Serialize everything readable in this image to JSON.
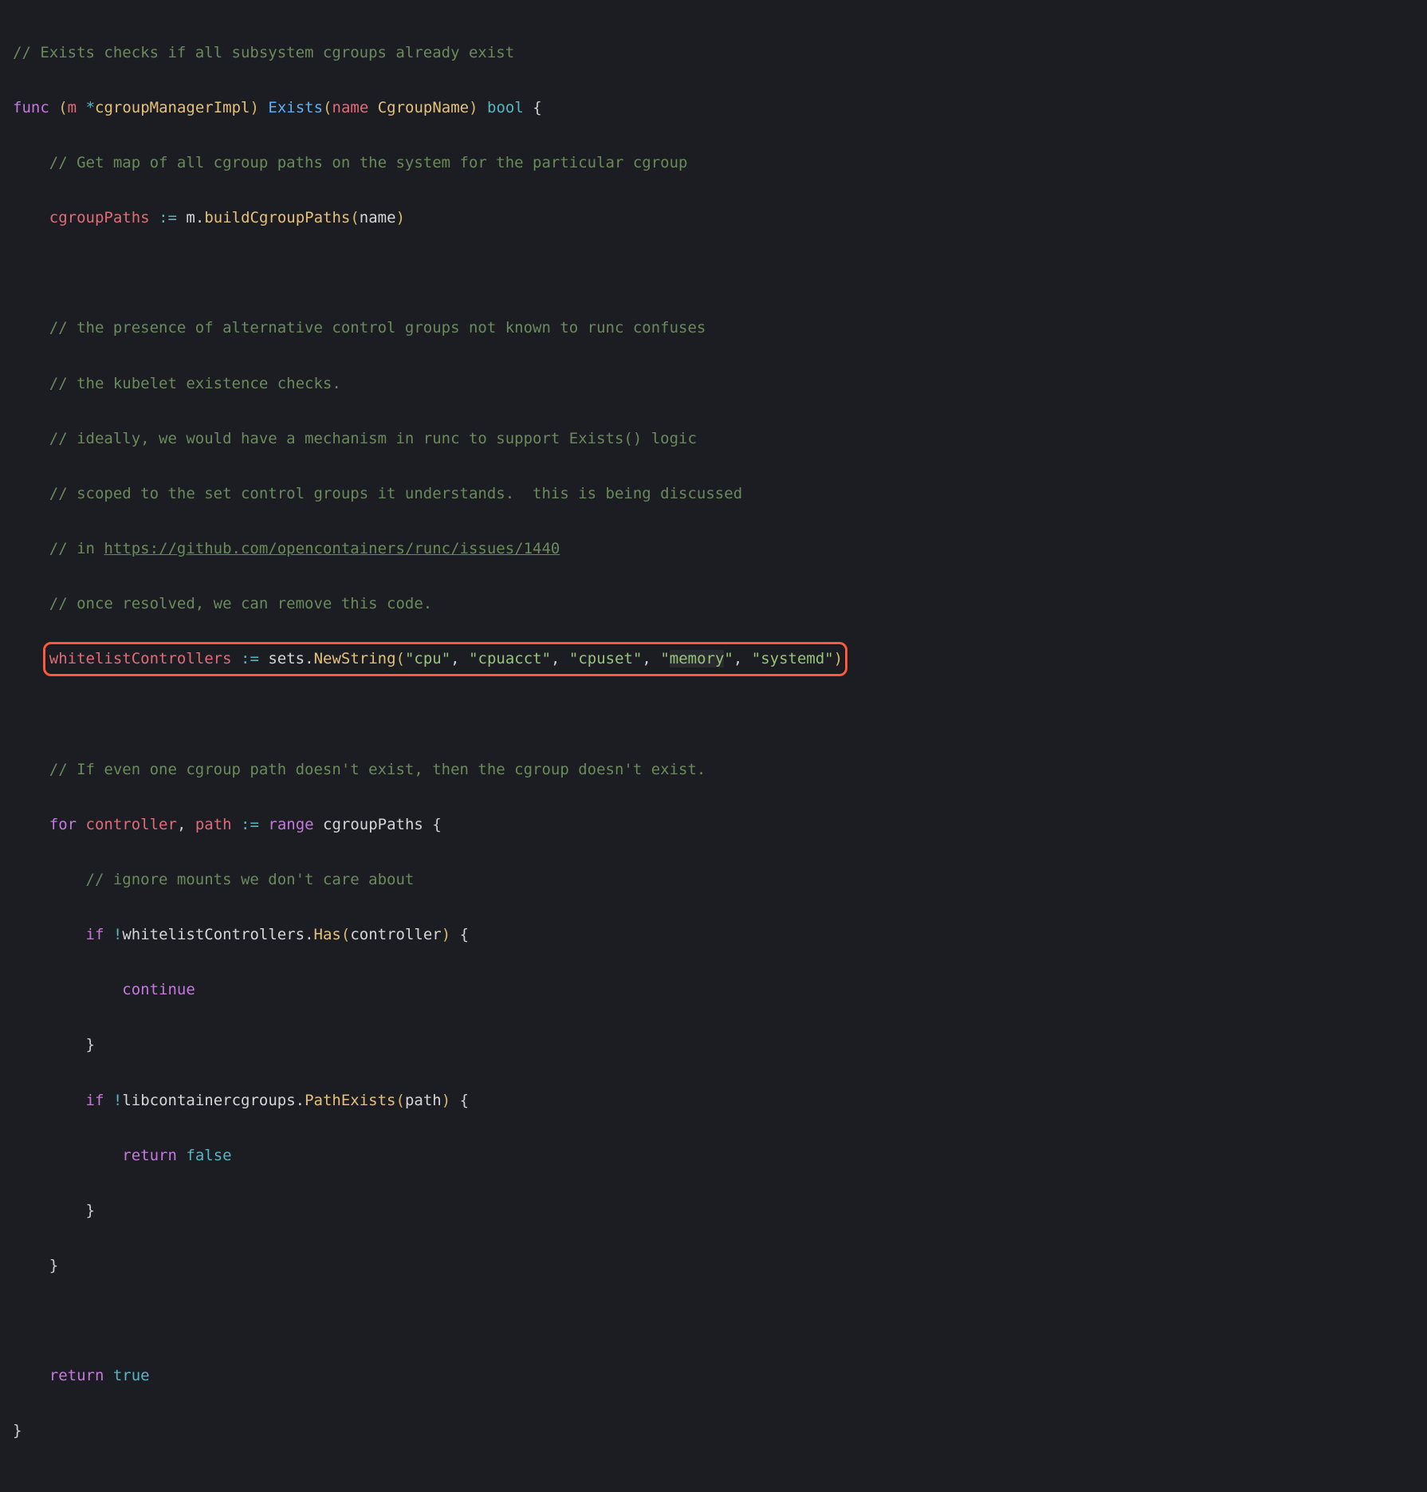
{
  "code": {
    "c_exists_doc": "// Exists checks if all subsystem cgroups already exist",
    "kw_func": "func",
    "recv_open": "(",
    "recv_m": "m",
    "recv_star": "*",
    "recv_type": "cgroupManagerImpl",
    "recv_close": ")",
    "fn_name": "Exists",
    "param_open": "(",
    "param_name": "name",
    "param_type": "CgroupName",
    "param_close": ")",
    "ret_type": "bool",
    "brace_open": "{",
    "c_getmap": "// Get map of all cgroup paths on the system for the particular cgroup",
    "var_cgroupPaths": "cgroupPaths",
    "op_shortdecl": ":=",
    "m_dot": "m",
    "dot": ".",
    "call_buildCgroupPaths": "buildCgroupPaths",
    "arg_name": "name",
    "c_presence1": "// the presence of alternative control groups not known to runc confuses",
    "c_presence2": "// the kubelet existence checks.",
    "c_presence3": "// ideally, we would have a mechanism in runc to support Exists() logic",
    "c_presence4": "// scoped to the set control groups it understands.  this is being discussed",
    "c_presence5a": "// in ",
    "c_presence5b_link": "https://github.com/opencontainers/runc/issues/1440",
    "c_presence6": "// once resolved, we can remove this code.",
    "var_whitelist": "whitelistControllers",
    "sets": "sets",
    "call_NewString": "NewString",
    "str_cpu": "\"cpu\"",
    "str_cpuacct": "\"cpuacct\"",
    "str_cpuset": "\"cpuset\"",
    "str_memory_open": "\"",
    "str_memory_word": "memory",
    "str_memory_close": "\"",
    "str_systemd": "\"systemd\"",
    "comma": ", ",
    "c_ifeven": "// If even one cgroup path doesn't exist, then the cgroup doesn't exist.",
    "kw_for": "for",
    "var_controller": "controller",
    "var_path": "path",
    "kw_range": "range",
    "c_ignore": "// ignore mounts we don't care about",
    "kw_if": "if",
    "bang": "!",
    "call_Has": "Has",
    "kw_continue": "continue",
    "brace_close": "}",
    "libcg": "libcontainercgroups",
    "call_PathExists": "PathExists",
    "kw_return": "return",
    "bool_false": "false",
    "bool_true": "true"
  }
}
